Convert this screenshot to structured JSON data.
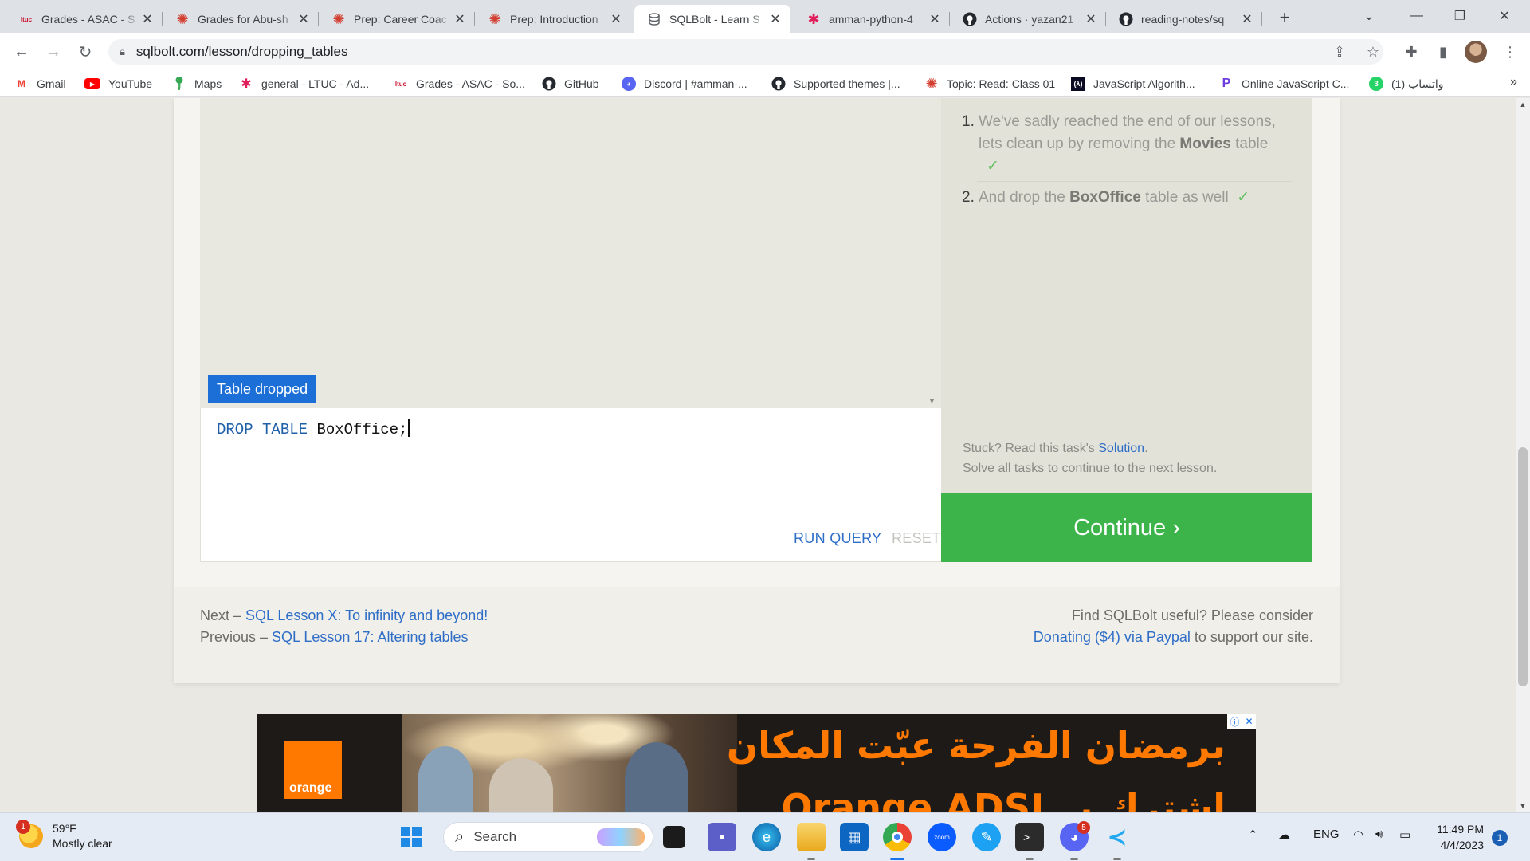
{
  "browser": {
    "tabs": [
      {
        "title": "Grades - ASAC - S",
        "icon": "ltuc-logo",
        "color": "#c8102e"
      },
      {
        "title": "Grades for Abu-sh",
        "icon": "asac-gear-logo",
        "color": "#d23f31"
      },
      {
        "title": "Prep: Career Coac",
        "icon": "asac-gear-logo",
        "color": "#d23f31"
      },
      {
        "title": "Prep: Introduction",
        "icon": "asac-gear-logo",
        "color": "#d23f31"
      },
      {
        "title": "SQLBolt - Learn S",
        "icon": "database-icon",
        "color": "#5f6368",
        "active": true
      },
      {
        "title": "amman-python-4",
        "icon": "slack-icon",
        "color": "#e01e5a"
      },
      {
        "title": "Actions · yazan21",
        "icon": "github-icon",
        "color": "#24292f"
      },
      {
        "title": "reading-notes/sq",
        "icon": "github-icon",
        "color": "#24292f"
      }
    ],
    "new_tab": "+",
    "url": "sqlbolt.com/lesson/dropping_tables",
    "bookmarks": [
      {
        "label": "Gmail",
        "icon": "gmail-icon",
        "glyph": "M",
        "color": "#ea4335"
      },
      {
        "label": "YouTube",
        "icon": "youtube-icon",
        "glyph": "▶",
        "color": "#ff0000"
      },
      {
        "label": "Maps",
        "icon": "maps-icon",
        "glyph": "◆",
        "color": "#34a853"
      },
      {
        "label": "general - LTUC - Ad...",
        "icon": "slack-icon",
        "glyph": "✱",
        "color": "#e01e5a"
      },
      {
        "label": "Grades - ASAC - So...",
        "icon": "ltuc-logo",
        "glyph": "ltuc",
        "color": "#c8102e"
      },
      {
        "label": "GitHub",
        "icon": "github-icon",
        "glyph": "●",
        "color": "#24292f"
      },
      {
        "label": "Discord | #amman-...",
        "icon": "discord-icon",
        "glyph": "◉",
        "color": "#5865f2"
      },
      {
        "label": "Supported themes |...",
        "icon": "github-icon",
        "glyph": "●",
        "color": "#24292f"
      },
      {
        "label": "Topic: Read: Class 01",
        "icon": "asac-gear-logo",
        "glyph": "✺",
        "color": "#d23f31"
      },
      {
        "label": "JavaScript Algorith...",
        "icon": "freecodecamp-icon",
        "glyph": "(λ)",
        "color": "#0a0a23"
      },
      {
        "label": "Online JavaScript C...",
        "icon": "programiz-icon",
        "glyph": "P",
        "color": "#6c3ce0"
      },
      {
        "label": "واتساب (1)",
        "icon": "whatsapp-icon",
        "glyph": "3",
        "color": "#25d366"
      }
    ]
  },
  "lesson": {
    "status_badge": "Table dropped",
    "query_keyword_1": "DROP",
    "query_keyword_2": "TABLE",
    "query_table": "BoxOffice;",
    "run_query": "RUN QUERY",
    "reset": "RESET",
    "tasks": [
      {
        "number": "1.",
        "line1": "We've sadly reached the end of our lessons,",
        "line2_pre": "lets clean up by removing the ",
        "line2_bold": "Movies",
        "line2_post": " table",
        "check": "✓"
      },
      {
        "number": "2.",
        "pre": "And drop the ",
        "bold": "BoxOffice",
        "post": " table as well",
        "check": "✓"
      }
    ],
    "stuck_pre": "Stuck? Read this task's ",
    "stuck_link": "Solution",
    "stuck_post": ".",
    "solve_all": "Solve all tasks to continue to the next lesson.",
    "continue": "Continue ›"
  },
  "footer": {
    "next_pre": "Next – ",
    "next_link": "SQL Lesson X: To infinity and beyond!",
    "prev_pre": "Previous – ",
    "prev_link": "SQL Lesson 17: Altering tables",
    "useful": "Find SQLBolt useful? Please consider",
    "donate_link": "Donating ($4) via Paypal",
    "donate_post": " to support our site."
  },
  "ad": {
    "logo": "orange",
    "headline": "برمضان الفرحة عبّت المكان",
    "subline": "اشترك بـ Orange ADSL",
    "brand_color": "#ff7900"
  },
  "taskbar": {
    "weather_temp": "59°F",
    "weather_desc": "Mostly clear",
    "weather_badge": "1",
    "search": "Search",
    "discord_badge": "5",
    "language": "ENG",
    "time": "11:49 PM",
    "date": "4/4/2023",
    "notification_count": "1"
  }
}
